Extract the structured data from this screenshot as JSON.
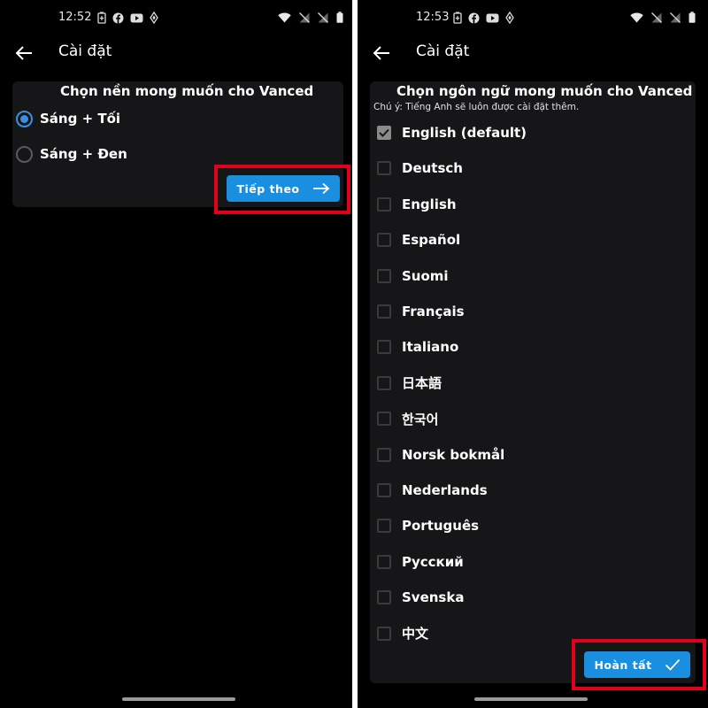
{
  "left_screen": {
    "status": {
      "time": "12:52"
    },
    "appbar": {
      "title": "Cài đặt"
    },
    "card": {
      "title": "Chọn nền mong muốn cho Vanced",
      "options": [
        {
          "label": "Sáng + Tối",
          "selected": true
        },
        {
          "label": "Sáng + Đen",
          "selected": false
        }
      ],
      "next_button": "Tiếp theo"
    }
  },
  "right_screen": {
    "status": {
      "time": "12:53"
    },
    "appbar": {
      "title": "Cài đặt"
    },
    "card": {
      "title": "Chọn ngôn ngữ mong muốn cho Vanced",
      "note": "Chú ý: Tiếng Anh sẽ luôn được cài đặt thêm.",
      "languages": [
        {
          "label": "English (default)",
          "checked": true
        },
        {
          "label": "Deutsch",
          "checked": false
        },
        {
          "label": "English",
          "checked": false
        },
        {
          "label": "Español",
          "checked": false
        },
        {
          "label": "Suomi",
          "checked": false
        },
        {
          "label": "Français",
          "checked": false
        },
        {
          "label": "Italiano",
          "checked": false
        },
        {
          "label": "日本語",
          "checked": false
        },
        {
          "label": "한국어",
          "checked": false
        },
        {
          "label": "Norsk bokmål",
          "checked": false
        },
        {
          "label": "Nederlands",
          "checked": false
        },
        {
          "label": "Português",
          "checked": false
        },
        {
          "label": "Русский",
          "checked": false
        },
        {
          "label": "Svenska",
          "checked": false
        },
        {
          "label": "中文",
          "checked": false
        }
      ],
      "done_button": "Hoàn tất"
    }
  },
  "colors": {
    "accent": "#1a8fe0",
    "highlight": "#e3001b",
    "card_bg": "#161618"
  }
}
